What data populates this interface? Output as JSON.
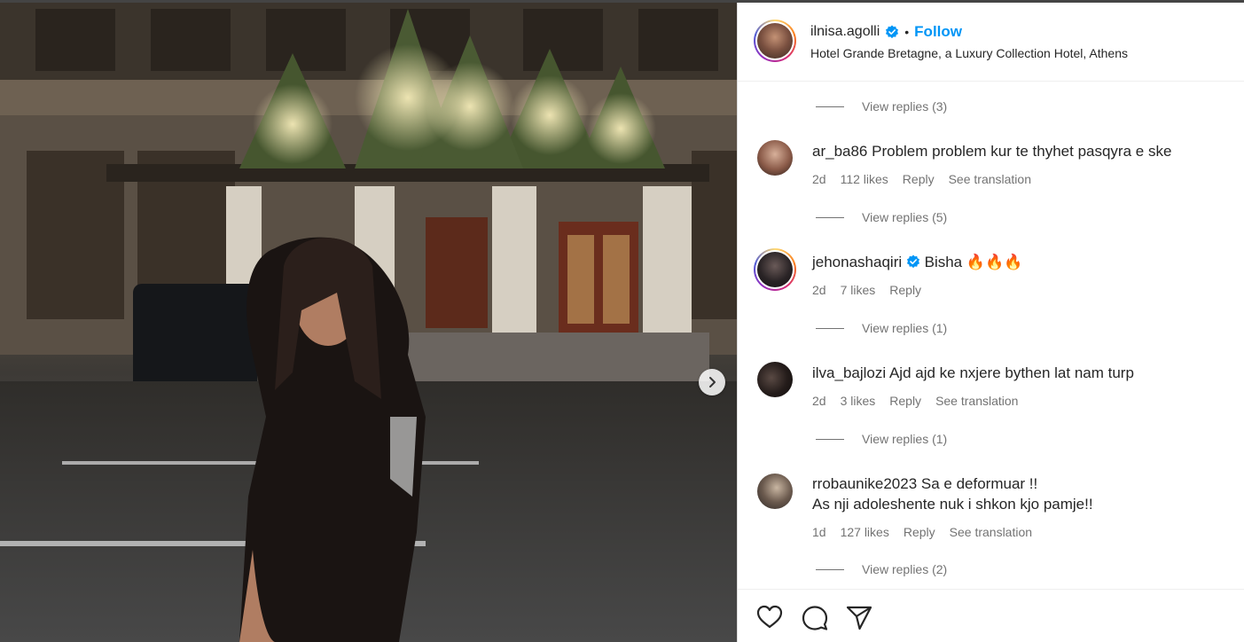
{
  "post": {
    "username": "ilnisa.agolli",
    "separator": "•",
    "follow_label": "Follow",
    "location": "Hotel Grande Bretagne, a Luxury Collection Hotel, Athens"
  },
  "comments": [
    {
      "replies_label": "View replies (3)"
    },
    {
      "author": "ar_ba86",
      "text": "Problem problem kur te thyhet pasqyra e ske",
      "time": "2d",
      "likes": "112 likes",
      "reply": "Reply",
      "translate": "See translation",
      "replies_label": "View replies (5)"
    },
    {
      "author": "jehonashaqiri",
      "text": "Bisha 🔥🔥🔥",
      "time": "2d",
      "likes": "7 likes",
      "reply": "Reply",
      "replies_label": "View replies (1)"
    },
    {
      "author": "ilva_bajlozi",
      "text": "Ajd ajd ke nxjere bythen lat nam turp",
      "time": "2d",
      "likes": "3 likes",
      "reply": "Reply",
      "translate": "See translation",
      "replies_label": "View replies (1)"
    },
    {
      "author": "rrobaunike2023",
      "text": "Sa e deformuar !!",
      "text2": "As nji adoleshente nuk i shkon kjo pamje!!",
      "time": "1d",
      "likes": "127 likes",
      "reply": "Reply",
      "translate": "See translation",
      "replies_label": "View replies (2)"
    }
  ],
  "colors": {
    "accent": "#0095f6",
    "verified": "#0095f6",
    "muted": "#737373"
  },
  "icons": [
    "chevron-right-icon",
    "verified-badge-icon",
    "heart-icon",
    "comment-icon",
    "share-icon"
  ]
}
